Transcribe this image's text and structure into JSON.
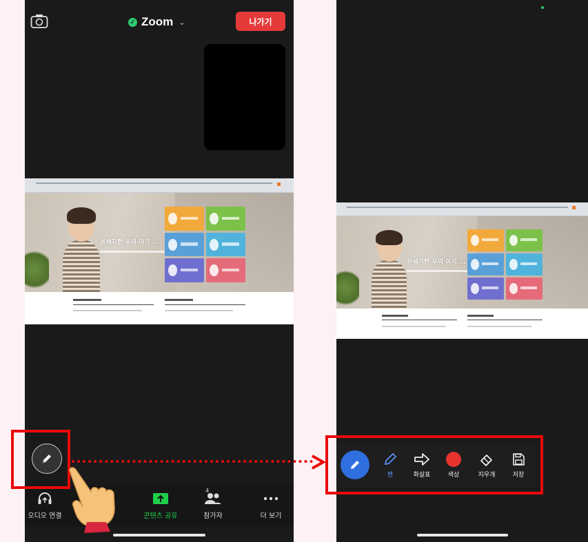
{
  "left_phone": {
    "meeting_title": "Zoom",
    "leave_label": "나가기",
    "hero_text": "온세지한 우리 아기 ...",
    "bottom_bar": {
      "audio_label": "오디오 연결",
      "share_label": "콘텐츠 공유",
      "participants_label": "참가자",
      "participants_count": "4",
      "more_label": "더 보기"
    }
  },
  "right_phone": {
    "hero_text": "온세지한 우리 아기 ...",
    "annotation_toolbar": {
      "pen_label": "펜",
      "spotlight_label": "화살표",
      "color_label": "색상",
      "eraser_label": "지우개",
      "save_label": "저장"
    }
  },
  "colors": {
    "highlight": "#ea0a0a",
    "leave_button": "#e53a3a",
    "share_active": "#1fcf4a",
    "annotate_active": "#2f6fe0",
    "pen_color": "#e8322e"
  },
  "icons": {
    "camera_switch": "camera-switch-icon",
    "shield": "shield-check-icon",
    "annotate": "pencil-icon",
    "audio": "headphones-icon",
    "share": "share-screen-icon",
    "participants": "people-icon",
    "more": "ellipsis-icon",
    "pen": "pen-icon",
    "arrow": "arrow-right-icon",
    "eraser": "eraser-icon",
    "save": "floppy-disk-icon",
    "hand": "hand-pointer-icon"
  }
}
